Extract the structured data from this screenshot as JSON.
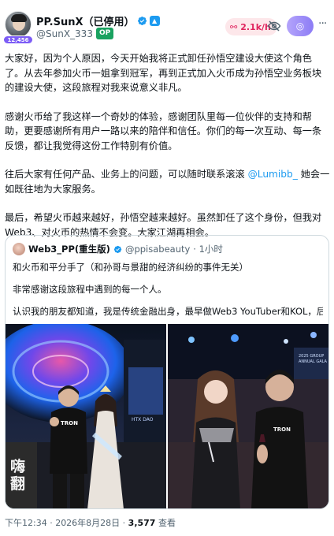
{
  "author": {
    "display_name": "PP.SunX（已停用）",
    "handle": "@SunX_333",
    "avatar_badge": "12,456",
    "op_badge": "OP",
    "verified_icon": "verified-badge-icon",
    "color_verified": "#1d9bf0"
  },
  "header": {
    "count_pill": "2.1k/h",
    "grok_icon": "grok-icon",
    "hide_icon": "eye-off-icon"
  },
  "tweet": {
    "paragraphs": [
      "大家好，因为个人原因，今天开始我将正式卸任孙悟空建设大使这个角色了。从去年参加火币一姐拿到冠军，再到正式加入火币成为孙悟空业务板块的建设大使，这段旅程对我来说意义非凡。",
      "感谢火币给了我这样一个奇妙的体验，感谢团队里每一位伙伴的支持和帮助，更要感谢所有用户一路以来的陪伴和信任。你们的每一次互动、每一条反馈，都让我觉得这份工作特别有价值。",
      "往后大家有任何产品、业务上的问题，可以随时联系滚滚",
      "最后，希望火币越来越好，孙悟空越来越好。虽然卸任了这个身份，但我对Web3、对火币的热情不会变。大家江湖再相会。"
    ],
    "mention": "@Lumibb_",
    "after_mention": " 她会一如既往地为大家服务。"
  },
  "quote": {
    "display_name": "Web3_PP(重生版)",
    "handle": "@ppisabeauty",
    "time": "· 1小时",
    "lines": [
      "和火币和平分手了（和孙哥与景甜的经济纠纷的事件无关）",
      "非常感谢这段旅程中遇到的每一个人。",
      "认识我的朋友都知道，我是传统金融出身，最早做Web3 YouTuber和KOL，后来..."
    ],
    "photo_left_shirt": "TRON",
    "photo_left_sign": "嗨翻",
    "photo_left_screen": "HTX DAO",
    "photo_right_shirt": "TRON",
    "photo_right_banner": "2025 GROUP ANNUAL GALA"
  },
  "footer": {
    "time": "下午12:34 · 2026年8月28日 · ",
    "views": "3,577",
    "views_label": " 查看"
  }
}
